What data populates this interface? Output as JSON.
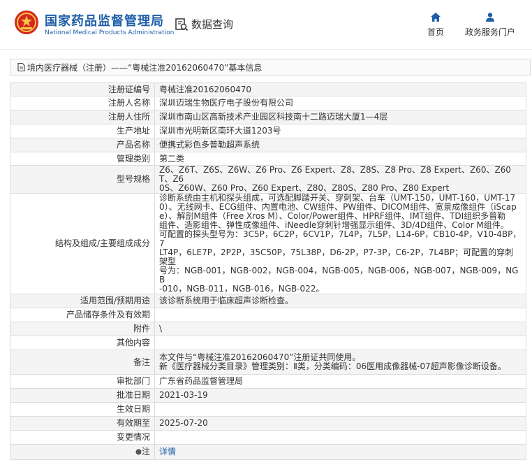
{
  "header": {
    "brand_cn": "国家药品监督管理局",
    "brand_en": "National Medical Products Administration",
    "data_query": "数据查询",
    "nav_home": "首页",
    "nav_service": "政务服务门户"
  },
  "breadcrumb": "境内医疗器械（注册）——“粤械注准20162060470”基本信息",
  "rows": [
    {
      "label": "注册证编号",
      "value": "粤械注准20162060470"
    },
    {
      "label": "注册人名称",
      "value": "深圳迈瑞生物医疗电子股份有限公司"
    },
    {
      "label": "注册人住所",
      "value": "深圳市南山区高新技术产业园区科技南十二路迈瑞大厦1—4层"
    },
    {
      "label": "生产地址",
      "value": "深圳市光明新区南环大道1203号"
    },
    {
      "label": "产品名称",
      "value": "便携式彩色多普勒超声系统"
    },
    {
      "label": "管理类别",
      "value": "第二类"
    },
    {
      "label": "型号规格",
      "value": "Z6、Z6T、Z6S、Z6W、Z6 Pro、Z6 Expert、Z8、Z8S、Z8 Pro、Z8 Expert、Z60、Z60T、Z6\n0S、Z60W、Z60 Pro、Z60 Expert、Z80、Z80S、Z80 Pro、Z80 Expert"
    },
    {
      "label": "结构及组成/主要组成成分",
      "value": "诊断系统由主机和探头组成，可选配脚踏开关、穿刺架、台车（UMT-150，UMT-160，UMT-17\n0）、无线网卡、ECG组件、内置电池、CW组件、PW组件、DICOM组件、宽景成像组件（iScap\ne）、解剖M组件（Free Xros M）、Color/Power组件、HPRF组件、IMT组件、TDI组织多普勒\n组件、造影组件、弹性成像组件、iNeedle穿刺针增强显示组件、3D/4D组件、Color M组件。\n可配置的探头型号为：3C5P，6C2P，6CV1P，7L4P，7L5P，L14-6P，CB10-4P，V10-4BP，7\nLT4P，6LE7P，2P2P，35C50P，75L38P，D6-2P，P7-3P，C6-2P，7L4BP；可配置的穿刺架型\n号为：NGB-001，NGB-002，NGB-004，NGB-005，NGB-006，NGB-007，NGB-009，NGB\n-010，NGB-011，NGB-016，NGB-022。"
    },
    {
      "label": "适用范围/预期用途",
      "value": "该诊断系统用于临床超声诊断检查。"
    },
    {
      "label": "产品储存条件及有效期",
      "value": ""
    },
    {
      "label": "附件",
      "value": "\\"
    },
    {
      "label": "其他内容",
      "value": ""
    },
    {
      "label": "备注",
      "value": "本文件与“粤械注准20162060470”注册证共同使用。\n新《医疗器械分类目录》管理类别：Ⅱ类，分类编码：06医用成像器械-07超声影像诊断设备。"
    },
    {
      "label": "审批部门",
      "value": "广东省药品监督管理局"
    },
    {
      "label": "批准日期",
      "value": "2021-03-19"
    },
    {
      "label": "生效日期",
      "value": ""
    },
    {
      "label": "有效期至",
      "value": "2025-07-20"
    },
    {
      "label": "变更情况",
      "value": ""
    },
    {
      "label": "注",
      "value": "详情",
      "is_link": true,
      "label_icon": "bullet-icon"
    }
  ],
  "colors": {
    "brand": "#1f5fa8",
    "row_alt": "#f4f4f4",
    "border": "#dcdcdc"
  }
}
